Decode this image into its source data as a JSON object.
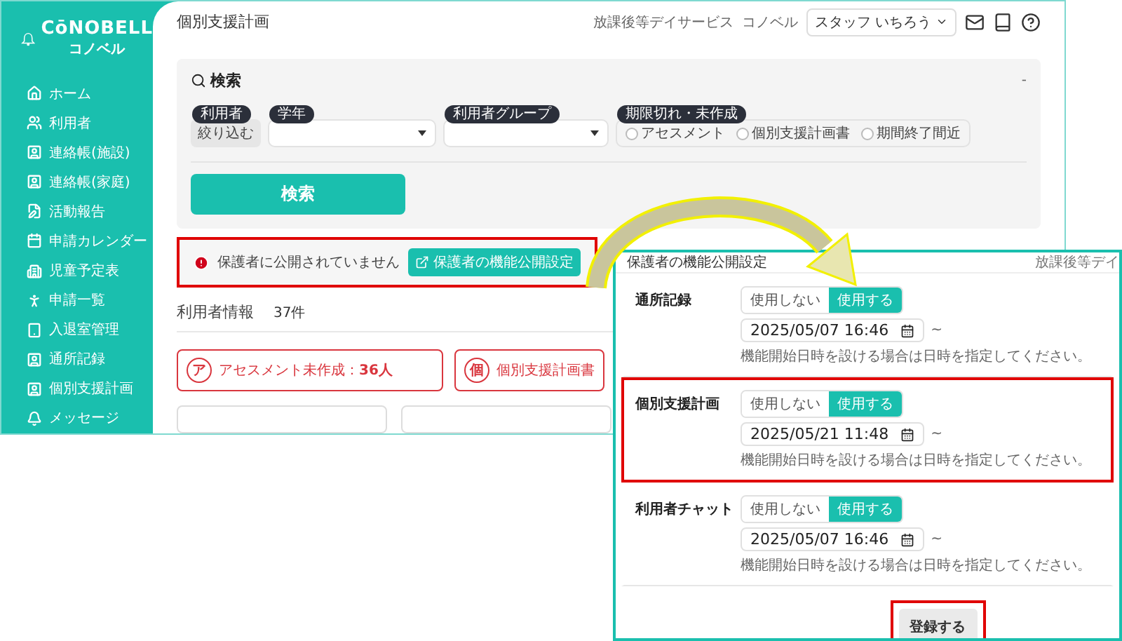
{
  "main_window": {
    "logo": {
      "name": "CōNOBELL",
      "sub": "コノベル"
    },
    "nav": [
      {
        "label": "ホーム"
      },
      {
        "label": "利用者"
      },
      {
        "label": "連絡帳(施設)"
      },
      {
        "label": "連絡帳(家庭)"
      },
      {
        "label": "活動報告"
      },
      {
        "label": "申請カレンダー"
      },
      {
        "label": "児童予定表"
      },
      {
        "label": "申請一覧"
      },
      {
        "label": "入退室管理"
      },
      {
        "label": "通所記録"
      },
      {
        "label": "個別支援計画"
      },
      {
        "label": "メッセージ"
      }
    ],
    "page_title": "個別支援計画",
    "header": {
      "facility": "放課後等デイサービス",
      "org": "コノベル",
      "staff_select": "スタッフ いちろう"
    },
    "search": {
      "title": "検索",
      "collapse": "-",
      "filters": [
        {
          "kind": "button",
          "label": "利用者",
          "value": "絞り込む"
        },
        {
          "kind": "select",
          "label": "学年"
        },
        {
          "kind": "select",
          "label": "利用者グループ"
        },
        {
          "kind": "radios",
          "label": "期限切れ・未作成",
          "options": [
            {
              "label": "アセスメント",
              "selected": false
            },
            {
              "label": "個別支援計画書",
              "selected": false
            },
            {
              "label": "期間終了間近",
              "selected": false
            }
          ]
        }
      ],
      "submit": "検索"
    },
    "alert": {
      "message": "保護者に公開されていません",
      "button": "保護者の機能公開設定",
      "highlighted": true
    },
    "users": {
      "title": "利用者情報",
      "count": "37件"
    },
    "summary_cards": [
      {
        "badge": "ア",
        "text": "アセスメント未作成：**36人**"
      },
      {
        "badge": "個",
        "text": "個別支援計画書"
      }
    ]
  },
  "settings_window": {
    "title": "保護者の機能公開設定",
    "header_right": "放課後等デイ",
    "rows": [
      {
        "label": "通所記録",
        "options": [
          {
            "label": "使用しない",
            "selected": false
          },
          {
            "label": "使用する",
            "selected": true
          }
        ],
        "datetime": "2025/05/07 16:46",
        "range_mark": "~",
        "hint": "機能開始日時を設ける場合は日時を指定してください。",
        "highlighted": false
      },
      {
        "label": "個別支援計画",
        "options": [
          {
            "label": "使用しない",
            "selected": false
          },
          {
            "label": "使用する",
            "selected": true
          }
        ],
        "datetime": "2025/05/21 11:48",
        "range_mark": "~",
        "hint": "機能開始日時を設ける場合は日時を指定してください。",
        "highlighted": true
      },
      {
        "label": "利用者チャット",
        "options": [
          {
            "label": "使用しない",
            "selected": false
          },
          {
            "label": "使用する",
            "selected": true
          }
        ],
        "datetime": "2025/05/07 16:46",
        "range_mark": "~",
        "hint": "機能開始日時を設ける場合は日時を指定してください。",
        "highlighted": false
      }
    ],
    "submit": {
      "label": "登録する",
      "highlighted": true
    }
  }
}
